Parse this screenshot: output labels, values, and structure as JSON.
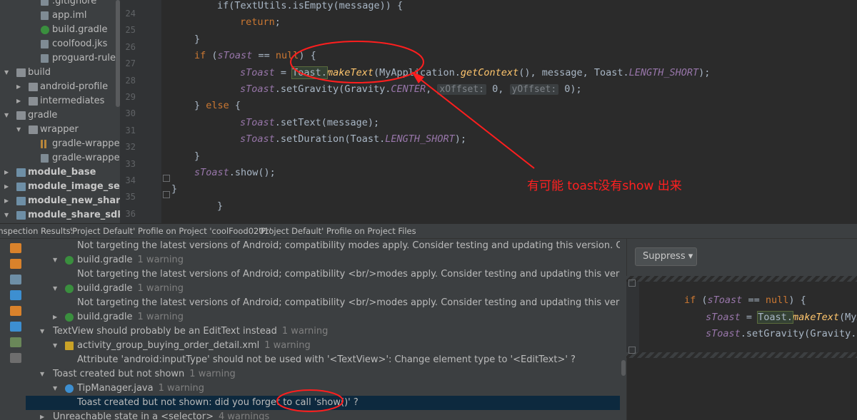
{
  "project_tree": [
    {
      "label": ".gitignore",
      "icon": "file-icon",
      "indent": 2,
      "arrow": ""
    },
    {
      "label": "app.iml",
      "icon": "file-icon",
      "indent": 2,
      "arrow": ""
    },
    {
      "label": "build.gradle",
      "icon": "gradle-icon",
      "indent": 2,
      "arrow": ""
    },
    {
      "label": "coolfood.jks",
      "icon": "file-icon",
      "indent": 2,
      "arrow": ""
    },
    {
      "label": "proguard-rules.pro",
      "icon": "file-icon",
      "indent": 2,
      "arrow": ""
    },
    {
      "label": "build",
      "icon": "folder-icon",
      "indent": 0,
      "arrow": "down"
    },
    {
      "label": "android-profile",
      "icon": "folder-icon",
      "indent": 1,
      "arrow": "right"
    },
    {
      "label": "intermediates",
      "icon": "folder-icon",
      "indent": 1,
      "arrow": "right"
    },
    {
      "label": "gradle",
      "icon": "folder-icon",
      "indent": 0,
      "arrow": "down"
    },
    {
      "label": "wrapper",
      "icon": "folder-icon",
      "indent": 1,
      "arrow": "down"
    },
    {
      "label": "gradle-wrapper.jar",
      "icon": "jar-icon",
      "indent": 2,
      "arrow": ""
    },
    {
      "label": "gradle-wrapper.properties",
      "icon": "file-icon",
      "indent": 2,
      "arrow": ""
    },
    {
      "label": "module_base",
      "icon": "module-icon",
      "indent": 0,
      "arrow": "right",
      "bold": true
    },
    {
      "label": "module_image_selector",
      "icon": "module-icon",
      "indent": 0,
      "arrow": "right",
      "bold": true
    },
    {
      "label": "module_new_share_sdk",
      "icon": "module-icon",
      "indent": 0,
      "arrow": "right",
      "bold": true
    },
    {
      "label": "module_share_sdk",
      "icon": "module-icon",
      "indent": 0,
      "arrow": "down",
      "bold": true
    }
  ],
  "editor": {
    "line_numbers": [
      "24",
      "25",
      "26",
      "27",
      "28",
      "29",
      "30",
      "31",
      "32",
      "33",
      "34",
      "35",
      "36"
    ],
    "lines": [
      {
        "indent": 0,
        "parts": [
          {
            "c": "",
            "t": "if(TextUtils.isEmpty(message)) {"
          }
        ]
      },
      {
        "indent": 3,
        "parts": [
          {
            "c": "kw",
            "t": "return"
          },
          {
            "c": "",
            "t": ";"
          }
        ]
      },
      {
        "indent": 2,
        "parts": [
          {
            "c": "",
            "t": "}"
          }
        ]
      },
      {
        "indent": 2,
        "parts": [
          {
            "c": "kw",
            "t": "if "
          },
          {
            "c": "",
            "t": "("
          },
          {
            "c": "fld",
            "t": "sToast"
          },
          {
            "c": "",
            "t": " == "
          },
          {
            "c": "kw",
            "t": "null"
          },
          {
            "c": "",
            "t": ") {"
          }
        ]
      },
      {
        "indent": 3,
        "parts": [
          {
            "c": "fld",
            "t": "sToast"
          },
          {
            "c": "",
            "t": " = "
          },
          {
            "c": "hl",
            "t": "Toast."
          },
          {
            "c": "mth",
            "t": "makeText"
          },
          {
            "c": "",
            "t": "(MyApplication."
          },
          {
            "c": "mth",
            "t": "getContext"
          },
          {
            "c": "",
            "t": "(), message, Toast."
          },
          {
            "c": "cst",
            "t": "LENGTH_SHORT"
          },
          {
            "c": "",
            "t": ");"
          }
        ]
      },
      {
        "indent": 3,
        "parts": [
          {
            "c": "fld",
            "t": "sToast"
          },
          {
            "c": "",
            "t": ".setGravity(Gravity."
          },
          {
            "c": "cst",
            "t": "CENTER"
          },
          {
            "c": "",
            "t": ", "
          },
          {
            "c": "hint",
            "t": "xOffset:"
          },
          {
            "c": "",
            "t": " 0, "
          },
          {
            "c": "hint",
            "t": "yOffset:"
          },
          {
            "c": "",
            "t": " 0);"
          }
        ]
      },
      {
        "indent": 2,
        "parts": [
          {
            "c": "",
            "t": "} "
          },
          {
            "c": "kw",
            "t": "else"
          },
          {
            "c": "",
            "t": " {"
          }
        ]
      },
      {
        "indent": 3,
        "parts": [
          {
            "c": "fld",
            "t": "sToast"
          },
          {
            "c": "",
            "t": ".setText(message);"
          }
        ]
      },
      {
        "indent": 3,
        "parts": [
          {
            "c": "fld",
            "t": "sToast"
          },
          {
            "c": "",
            "t": ".setDuration(Toast."
          },
          {
            "c": "cst",
            "t": "LENGTH_SHORT"
          },
          {
            "c": "",
            "t": ");"
          }
        ]
      },
      {
        "indent": 2,
        "parts": [
          {
            "c": "",
            "t": "}"
          }
        ]
      },
      {
        "indent": 2,
        "parts": [
          {
            "c": "fld",
            "t": "sToast"
          },
          {
            "c": "",
            "t": ".show();"
          }
        ]
      },
      {
        "indent": 1,
        "parts": [
          {
            "c": "",
            "t": "}"
          }
        ]
      },
      {
        "indent": 0,
        "parts": [
          {
            "c": "",
            "t": "}"
          }
        ]
      }
    ]
  },
  "inspection": {
    "tabs": [
      "Inspection Results:",
      "'Project Default' Profile on Project 'coolFood0201'",
      "'Project Default' Profile on Project Files"
    ],
    "rows": [
      {
        "indent": 1,
        "arrow": "",
        "icon": "",
        "text": "Not targeting the latest versions of Android; compatibility modes apply. Consider testing and updating this version. Consult the 'android:targetSdkVersion'",
        "count": ""
      },
      {
        "indent": 0,
        "arrow": "down",
        "icon": "gradle-icon",
        "text": "build.gradle",
        "count": "1 warning"
      },
      {
        "indent": 1,
        "arrow": "",
        "icon": "",
        "text": "Not targeting the latest versions of Android; compatibility <br/>modes apply. Consider testing and updating this version. <br/>Consult the",
        "count": ""
      },
      {
        "indent": 0,
        "arrow": "down",
        "icon": "gradle-icon",
        "text": "build.gradle",
        "count": "1 warning"
      },
      {
        "indent": 1,
        "arrow": "",
        "icon": "",
        "text": "Not targeting the latest versions of Android; compatibility <br/>modes apply. Consider testing and updating this version. <br/>Consult the",
        "count": ""
      },
      {
        "indent": 0,
        "arrow": "right",
        "icon": "gradle-icon",
        "text": "build.gradle",
        "count": "1 warning"
      },
      {
        "indent": -1,
        "arrow": "down",
        "icon": "",
        "text": "TextView should probably be an EditText instead",
        "count": "1 warning"
      },
      {
        "indent": 0,
        "arrow": "down",
        "icon": "xml-icon",
        "text": "activity_group_buying_order_detail.xml",
        "count": "1 warning"
      },
      {
        "indent": 1,
        "arrow": "",
        "icon": "",
        "text": "Attribute 'android:inputType' should not be used with '<TextView>': Change element type to '<EditText>' ?",
        "count": ""
      },
      {
        "indent": -1,
        "arrow": "down",
        "icon": "",
        "text": "Toast created but not shown",
        "count": "1 warning"
      },
      {
        "indent": 0,
        "arrow": "down",
        "icon": "java-icon",
        "text": "TipManager.java",
        "count": "1 warning"
      },
      {
        "indent": 1,
        "arrow": "",
        "icon": "",
        "text": "Toast created but not shown: did you forget to call 'show()' ?",
        "count": "",
        "selected": true
      },
      {
        "indent": -1,
        "arrow": "right",
        "icon": "",
        "text": "Unreachable state in a <selector>",
        "count": "4 warnings"
      }
    ]
  },
  "preview": {
    "suppress_label": "Suppress ▾",
    "lines": [
      {
        "parts": [
          {
            "c": "kw",
            "t": "if "
          },
          {
            "c": "",
            "t": "("
          },
          {
            "c": "fld",
            "t": "sToast"
          },
          {
            "c": "",
            "t": " == "
          },
          {
            "c": "kw",
            "t": "null"
          },
          {
            "c": "",
            "t": ") {"
          }
        ]
      },
      {
        "parts": [
          {
            "c": "fld",
            "t": "sToast"
          },
          {
            "c": "",
            "t": " = "
          },
          {
            "c": "hl",
            "t": "Toast."
          },
          {
            "c": "mth",
            "t": "makeText"
          },
          {
            "c": "",
            "t": "(MyApplication."
          },
          {
            "c": "mth",
            "t": "getContext"
          },
          {
            "c": "",
            "t": "(), message, Toast."
          }
        ]
      },
      {
        "parts": [
          {
            "c": "fld",
            "t": "sToast"
          },
          {
            "c": "",
            "t": ".setGravity(Gravity."
          },
          {
            "c": "cst",
            "t": "CENTER"
          },
          {
            "c": "",
            "t": ", 0, 0);"
          }
        ]
      }
    ]
  },
  "annotation": {
    "text": "有可能 toast没有show 出来",
    "color": "#ff2020"
  }
}
